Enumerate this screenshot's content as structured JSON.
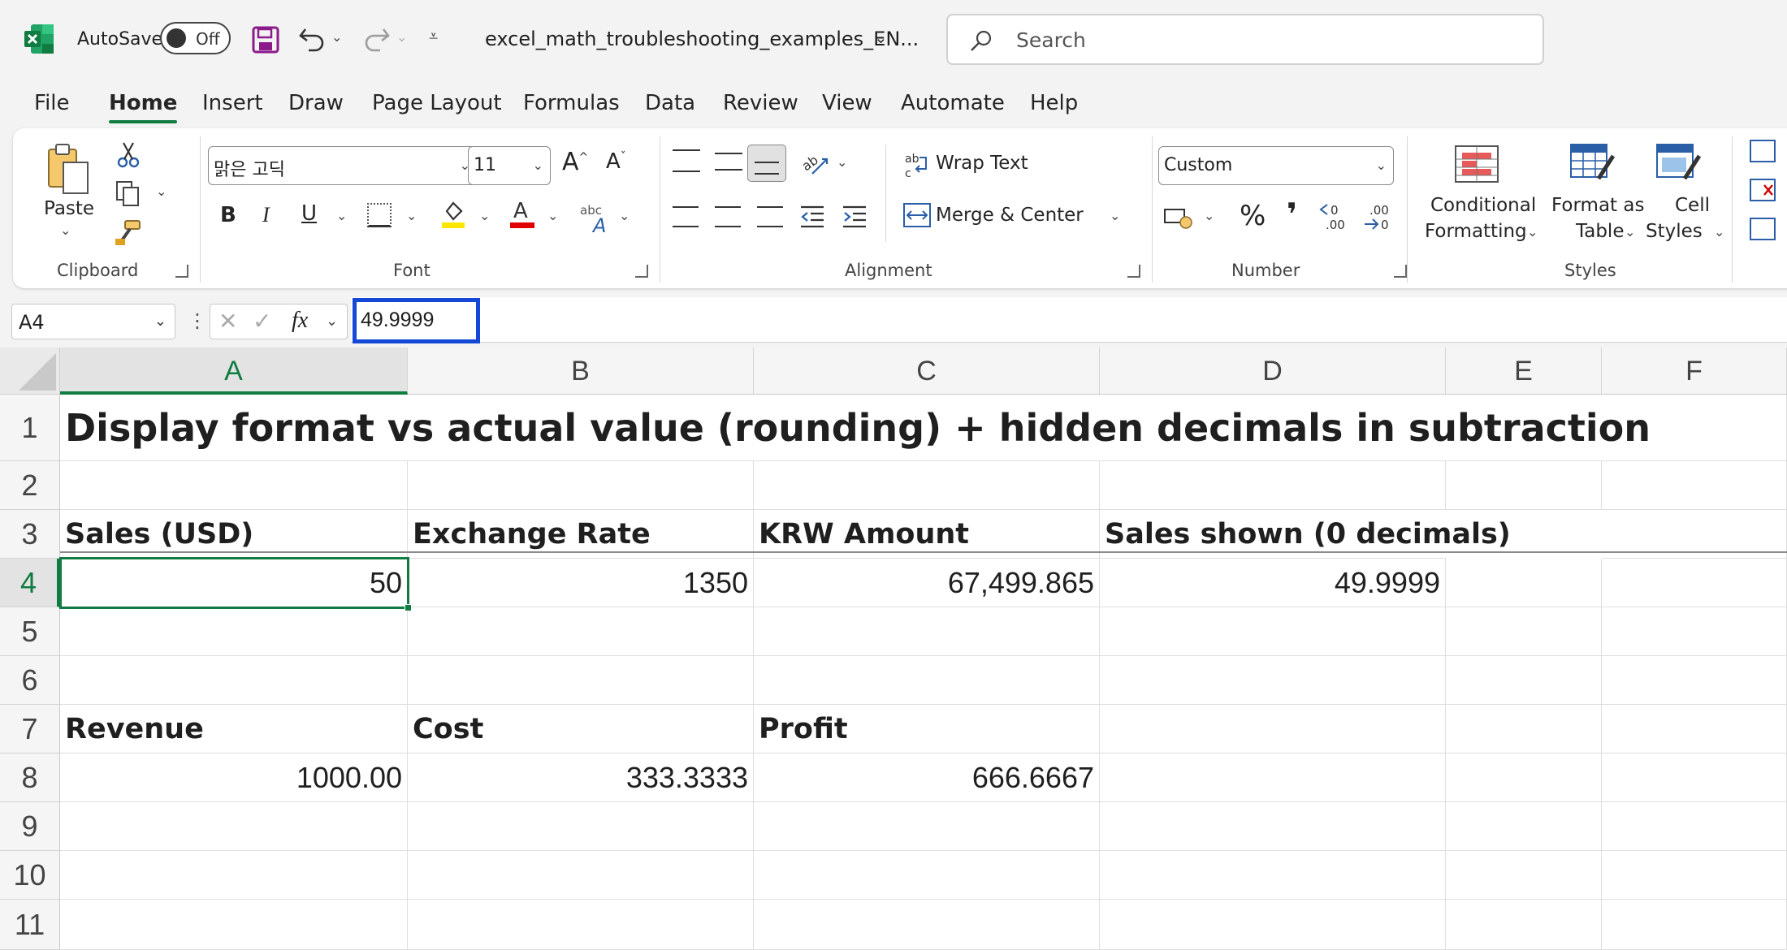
{
  "titlebar": {
    "autosave_label": "AutoSave",
    "autosave_state": "Off",
    "filename": "excel_math_troubleshooting_examples_EN...",
    "search_placeholder": "Search"
  },
  "menu": {
    "tabs": [
      "File",
      "Home",
      "Insert",
      "Draw",
      "Page Layout",
      "Formulas",
      "Data",
      "Review",
      "View",
      "Automate",
      "Help"
    ],
    "active": "Home"
  },
  "ribbon": {
    "clipboard": {
      "label": "Clipboard",
      "paste": "Paste"
    },
    "font": {
      "label": "Font",
      "name": "맑은 고딕",
      "size": "11",
      "bold": "B",
      "italic": "I",
      "underline": "U",
      "grow": "A",
      "shrink": "A",
      "phonetic": "abc"
    },
    "alignment": {
      "label": "Alignment",
      "wrap_text": "Wrap Text",
      "merge_center": "Merge & Center"
    },
    "number": {
      "label": "Number",
      "format": "Custom",
      "percent": "%",
      "comma": "❜",
      "inc_decimal": "←0\n.00",
      "dec_decimal": ".00\n→0"
    },
    "styles": {
      "label": "Styles",
      "conditional_1": "Conditional",
      "conditional_2": "Formatting",
      "format_table_1": "Format as",
      "format_table_2": "Table",
      "cell_styles_1": "Cell",
      "cell_styles_2": "Styles"
    }
  },
  "formula_bar": {
    "name_box": "A4",
    "fx": "fx",
    "value": "49.9999"
  },
  "sheet": {
    "columns": [
      "A",
      "B",
      "C",
      "D",
      "E",
      "F"
    ],
    "rows": [
      "1",
      "2",
      "3",
      "4",
      "5",
      "6",
      "7",
      "8",
      "9",
      "10",
      "11"
    ],
    "selected_cell": "A4",
    "title": "Display format vs actual value (rounding) + hidden decimals in subtraction",
    "row3": {
      "a": "Sales (USD)",
      "b": "Exchange Rate",
      "c": "KRW Amount",
      "d": "Sales shown (0 decimals)"
    },
    "row4": {
      "a": "50",
      "b": "1350",
      "c": "67,499.865",
      "d": "49.9999"
    },
    "row7": {
      "a": "Revenue",
      "b": "Cost",
      "c": "Profit"
    },
    "row8": {
      "a": "1000.00",
      "b": "333.3333",
      "c": "666.6667"
    }
  },
  "colors": {
    "accent_green": "#107c41",
    "highlight_blue": "#1448d6"
  }
}
